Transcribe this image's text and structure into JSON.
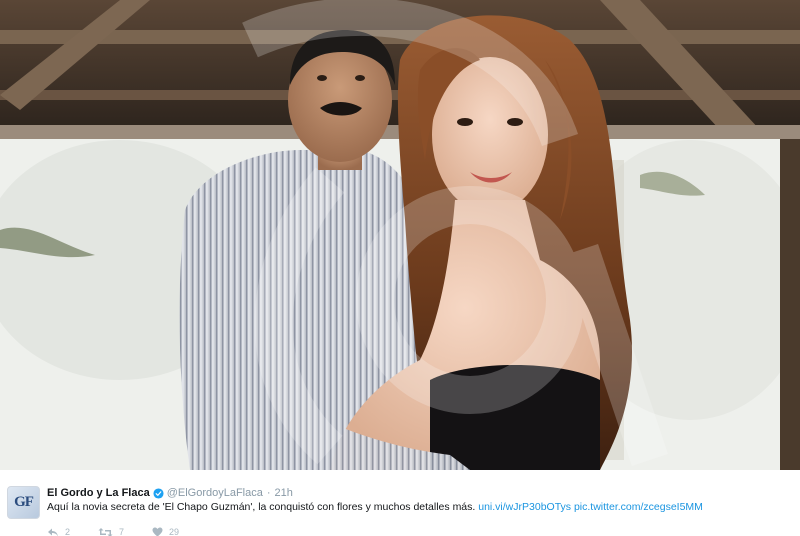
{
  "photo": {
    "description_icon": "photo-image",
    "watermark": "TVN"
  },
  "tweet": {
    "avatar_text": "GF",
    "display_name": "El Gordo y La Flaca",
    "verified_icon": "verified-badge-icon",
    "handle": "@ElGordoyLaFlaca",
    "separator": "·",
    "timestamp": "21h",
    "text": "Aquí la novia secreta de 'El Chapo Guzmán', la conquistó con flores y muchos detalles más.",
    "link1": "uni.vi/wJrP30bOTys",
    "link2": "pic.twitter.com/zcegseI5MM"
  },
  "actions": {
    "reply_icon": "reply-icon",
    "reply_count": "2",
    "retweet_icon": "retweet-icon",
    "retweet_count": "7",
    "like_icon": "heart-icon",
    "like_count": "29"
  },
  "colors": {
    "link": "#1b95e0",
    "verified": "#1da1f2",
    "muted": "#8899a6"
  }
}
